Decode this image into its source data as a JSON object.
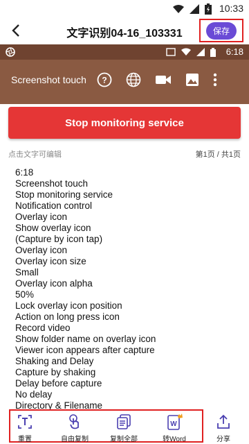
{
  "status_bar": {
    "time": "10:33",
    "icons": [
      "wifi-icon",
      "signal-icon",
      "battery-icon"
    ]
  },
  "app_bar": {
    "title": "文字识别04-16_103331",
    "save_label": "保存"
  },
  "screenshot": {
    "system_time": "6:18",
    "app_label": "Screenshot touch",
    "tool_icons": [
      "help-icon",
      "globe-icon",
      "video-icon",
      "image-icon",
      "more-icon"
    ]
  },
  "stop_button": {
    "label": "Stop monitoring service"
  },
  "hint_text": "点击文字可编辑",
  "page_indicator": "第1页 / 共1页",
  "recognized_lines": [
    "6:18",
    "Screenshot touch",
    "Stop monitoring service",
    "Notification control",
    "Overlay icon",
    "Show overlay icon",
    "(Capture by icon tap)",
    "Overlay icon",
    "Overlay icon size",
    "Small",
    "Overlay icon alpha",
    "50%",
    "Lock overlay icon position",
    "Action on long press icon",
    "Record video",
    "Show folder name on overlay icon",
    "Viewer icon appears after capture",
    "Shaking and Delay",
    "Capture by shaking",
    "Delay before capture",
    "No delay",
    "Directory & Filename"
  ],
  "bottom_bar": {
    "reset": "重置",
    "free_copy": "自由复制",
    "copy_all": "复制全部",
    "to_word": "转Word",
    "share": "分享"
  },
  "colors": {
    "accent": "#6a4bd6",
    "stop": "#e53636",
    "frame": "#e02020",
    "screenshot_bg": "#8a5a42"
  }
}
